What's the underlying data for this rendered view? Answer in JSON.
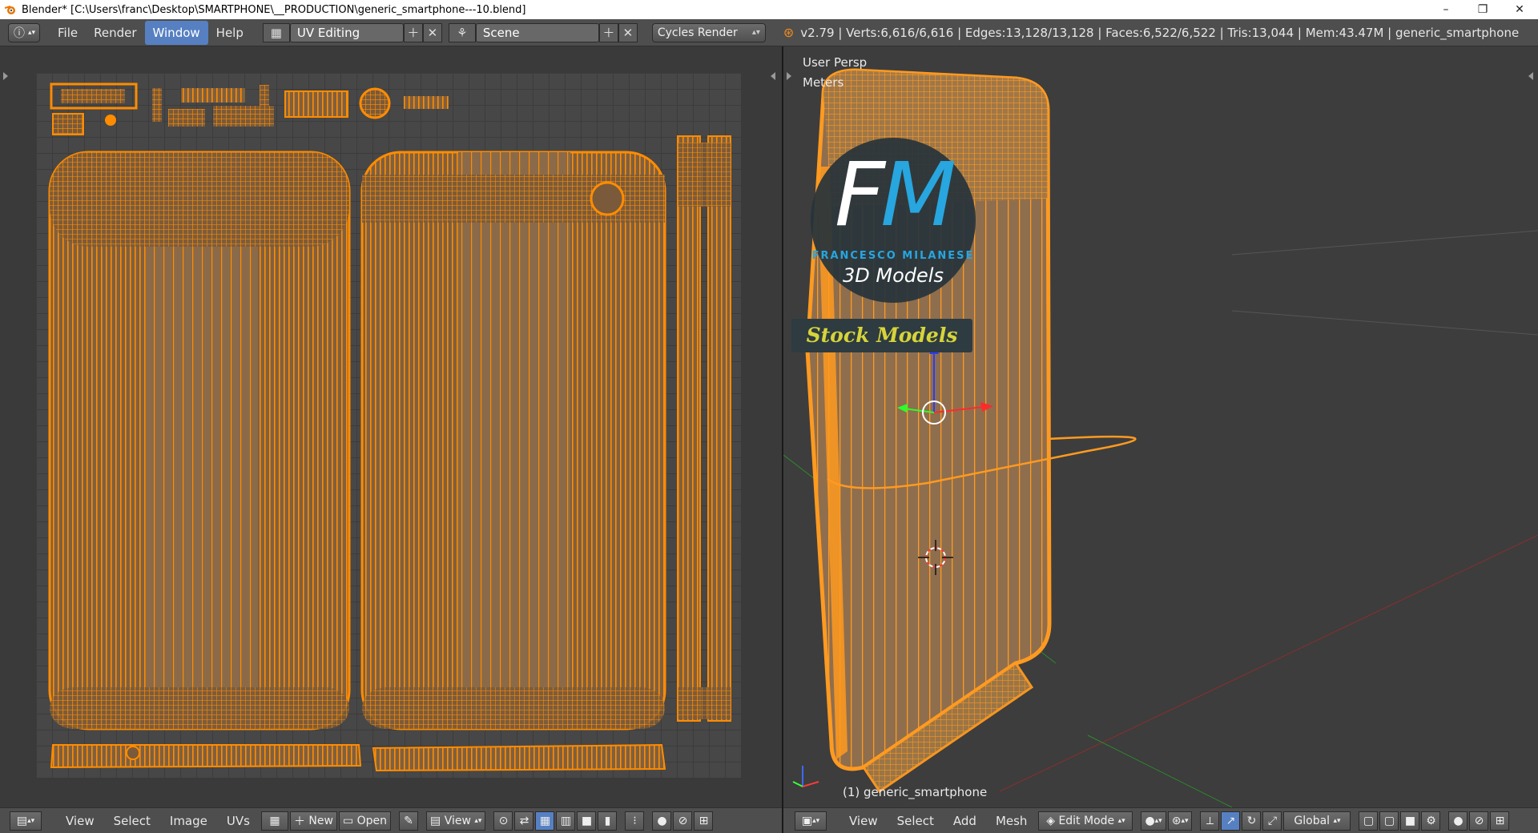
{
  "window": {
    "title": "Blender* [C:\\Users\\franc\\Desktop\\SMARTPHONE\\__PRODUCTION\\generic_smartphone---10.blend]",
    "minimize": "–",
    "restore": "❐",
    "close": "✕"
  },
  "info_header": {
    "menus": [
      "File",
      "Render",
      "Window",
      "Help"
    ],
    "active_menu": "Window",
    "layout": "UV Editing",
    "scene": "Scene",
    "engine": "Cycles Render",
    "stats": "v2.79 | Verts:6,616/6,616 | Edges:13,128/13,128 | Faces:6,522/6,522 | Tris:13,044 | Mem:43.47M | generic_smartphone"
  },
  "viewport": {
    "view_name": "User Persp",
    "units": "Meters",
    "object_label": "(1) generic_smartphone"
  },
  "logo": {
    "f": "F",
    "m": "M",
    "name": "FRANCESCO MILANESE",
    "sub": "3D Models",
    "stock": "Stock Models"
  },
  "uv_footer": {
    "view": "View",
    "select": "Select",
    "image": "Image",
    "uvs": "UVs",
    "new": "New",
    "open": "Open",
    "view2": "View"
  },
  "view3d_footer": {
    "view": "View",
    "select": "Select",
    "add": "Add",
    "mesh": "Mesh",
    "mode": "Edit Mode",
    "orientation": "Global"
  },
  "colors": {
    "wire": "#ff8c00",
    "face_fill": "#8a6a48",
    "accent": "#5680c2",
    "logo_blue": "#27a6e0",
    "stock_yellow": "#d6d43a"
  }
}
